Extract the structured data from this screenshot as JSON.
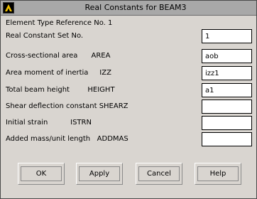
{
  "window": {
    "title": "Real Constants for BEAM3"
  },
  "header": {
    "element_type_ref": "Element Type Reference No. 1",
    "set_no_label": "Real Constant Set No.",
    "set_no_value": "1"
  },
  "fields": [
    {
      "label": "Cross-sectional area      AREA",
      "value": "aob"
    },
    {
      "label": "Area moment of inertia     IZZ",
      "value": "izz1"
    },
    {
      "label": "Total beam height        HEIGHT",
      "value": "a1"
    },
    {
      "label": "Shear deflection constant SHEARZ",
      "value": ""
    },
    {
      "label": "Initial strain          ISTRN",
      "value": ""
    },
    {
      "label": "Added mass/unit length   ADDMAS",
      "value": ""
    }
  ],
  "buttons": {
    "ok": "OK",
    "apply": "Apply",
    "cancel": "Cancel",
    "help": "Help"
  },
  "icons": {
    "app": "ansys-logo-icon"
  }
}
